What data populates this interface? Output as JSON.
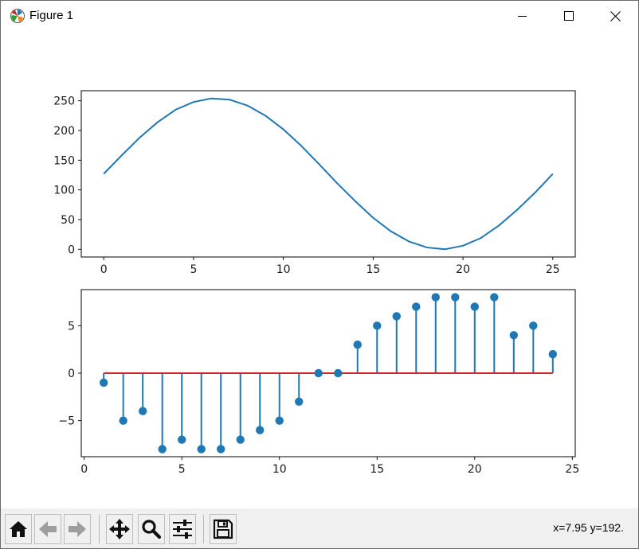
{
  "window": {
    "title": "Figure 1",
    "app_icon": "matplotlib-icon",
    "controls": [
      "minimize-icon",
      "maximize-icon",
      "close-icon"
    ]
  },
  "toolbar": {
    "buttons": [
      {
        "name": "home",
        "icon": "home-icon"
      },
      {
        "name": "back",
        "icon": "left-arrow-icon"
      },
      {
        "name": "forward",
        "icon": "right-arrow-icon"
      },
      {
        "name": "pan",
        "icon": "move-arrows-icon"
      },
      {
        "name": "zoom",
        "icon": "magnifier-icon"
      },
      {
        "name": "configure-subplots",
        "icon": "sliders-icon"
      },
      {
        "name": "save",
        "icon": "floppy-disk-icon"
      }
    ],
    "status": "x=7.95 y=192."
  },
  "colors": {
    "line": "#1f77b4",
    "baseline": "#d62728"
  },
  "chart_data": [
    {
      "type": "line",
      "x": [
        0,
        1,
        2,
        3,
        4,
        5,
        6,
        7,
        8,
        9,
        10,
        11,
        12,
        13,
        14,
        15,
        16,
        17,
        18,
        19,
        20,
        21,
        22,
        23,
        24,
        25
      ],
      "series": [
        {
          "values": [
            127,
            158,
            188,
            214,
            235,
            248,
            254,
            252,
            242,
            225,
            202,
            174,
            143,
            111,
            81,
            53,
            30,
            13,
            3,
            0,
            6,
            19,
            40,
            66,
            95,
            127
          ]
        }
      ],
      "xlim": [
        -1.25,
        26.25
      ],
      "ylim": [
        -13,
        267
      ],
      "xticks": [
        0,
        5,
        10,
        15,
        20,
        25
      ],
      "yticks": [
        0,
        50,
        100,
        150,
        200,
        250
      ]
    },
    {
      "type": "stem",
      "x": [
        1,
        2,
        3,
        4,
        5,
        6,
        7,
        8,
        9,
        10,
        11,
        12,
        13,
        14,
        15,
        16,
        17,
        18,
        19,
        20,
        21,
        22,
        23,
        24
      ],
      "series": [
        {
          "values": [
            -1,
            -5,
            -4,
            -8,
            -7,
            -8,
            -8,
            -7,
            -6,
            -5,
            -3,
            0,
            0,
            3,
            5,
            6,
            7,
            8,
            8,
            7,
            8,
            4,
            5,
            2
          ]
        }
      ],
      "baseline": 0,
      "xlim": [
        -0.15,
        25.15
      ],
      "ylim": [
        -8.8,
        8.8
      ],
      "xticks": [
        0,
        5,
        10,
        15,
        20,
        25
      ],
      "yticks": [
        -5,
        0,
        5
      ],
      "ytick_labels": [
        "−5",
        "0",
        "5"
      ]
    }
  ]
}
